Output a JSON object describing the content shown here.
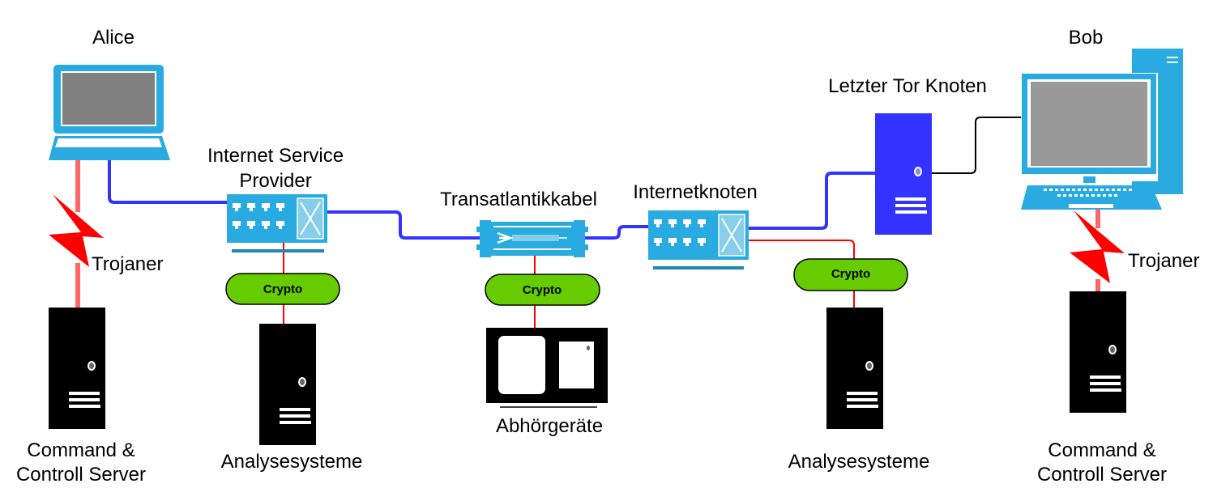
{
  "diagram": {
    "title": "",
    "colors": {
      "device_blue": "#29abe2",
      "device_blue_dark": "#1f88b0",
      "device_light": "#87ceeb",
      "screen_gray_laptop": "#808080",
      "screen_gray_desktop": "#999999",
      "link_blue": "#3333ff",
      "tor_node_blue": "#3333ff",
      "tap_red": "#ff0000",
      "trojan_pink": "#ff6666",
      "crypto_green": "#66cc00",
      "server_black": "#000000"
    },
    "nodes": {
      "alice": {
        "label": "Alice",
        "type": "laptop"
      },
      "isp": {
        "label_line1": "Internet Service",
        "label_line2": "Provider",
        "type": "switch"
      },
      "cable": {
        "label": "Transatlantikkabel",
        "type": "fiber-cable"
      },
      "internet_node": {
        "label": "Internetknoten",
        "type": "switch"
      },
      "tor_exit": {
        "label": "Letzter Tor Knoten",
        "type": "server"
      },
      "bob": {
        "label": "Bob",
        "type": "desktop-pc"
      },
      "cc_left": {
        "label_line1": "Command &",
        "label_line2": "Controll Server",
        "type": "server"
      },
      "cc_right": {
        "label_line1": "Command &",
        "label_line2": "Controll Server",
        "type": "server"
      },
      "analysis_left": {
        "label": "Analysesysteme",
        "type": "server"
      },
      "analysis_right": {
        "label": "Analysesysteme",
        "type": "server"
      },
      "tap_device": {
        "label": "Abhörgeräte",
        "type": "listening-device"
      }
    },
    "crypto_badges": [
      {
        "label": "Crypto",
        "attached_to": "isp"
      },
      {
        "label": "Crypto",
        "attached_to": "cable"
      },
      {
        "label": "Crypto",
        "attached_to": "internet_node"
      }
    ],
    "trojans": [
      {
        "label": "Trojaner",
        "between": [
          "alice",
          "cc_left"
        ]
      },
      {
        "label": "Trojaner",
        "between": [
          "bob",
          "cc_right"
        ]
      }
    ],
    "edges": [
      {
        "from": "alice",
        "to": "isp",
        "kind": "data-link"
      },
      {
        "from": "isp",
        "to": "cable",
        "kind": "data-link"
      },
      {
        "from": "cable",
        "to": "internet_node",
        "kind": "data-link"
      },
      {
        "from": "internet_node",
        "to": "tor_exit",
        "kind": "data-link"
      },
      {
        "from": "tor_exit",
        "to": "bob",
        "kind": "plain-link"
      },
      {
        "from": "isp",
        "to": "analysis_left",
        "kind": "tap"
      },
      {
        "from": "cable",
        "to": "tap_device",
        "kind": "tap"
      },
      {
        "from": "internet_node",
        "to": "analysis_right",
        "kind": "tap"
      },
      {
        "from": "alice",
        "to": "cc_left",
        "kind": "trojan"
      },
      {
        "from": "bob",
        "to": "cc_right",
        "kind": "trojan"
      }
    ]
  }
}
